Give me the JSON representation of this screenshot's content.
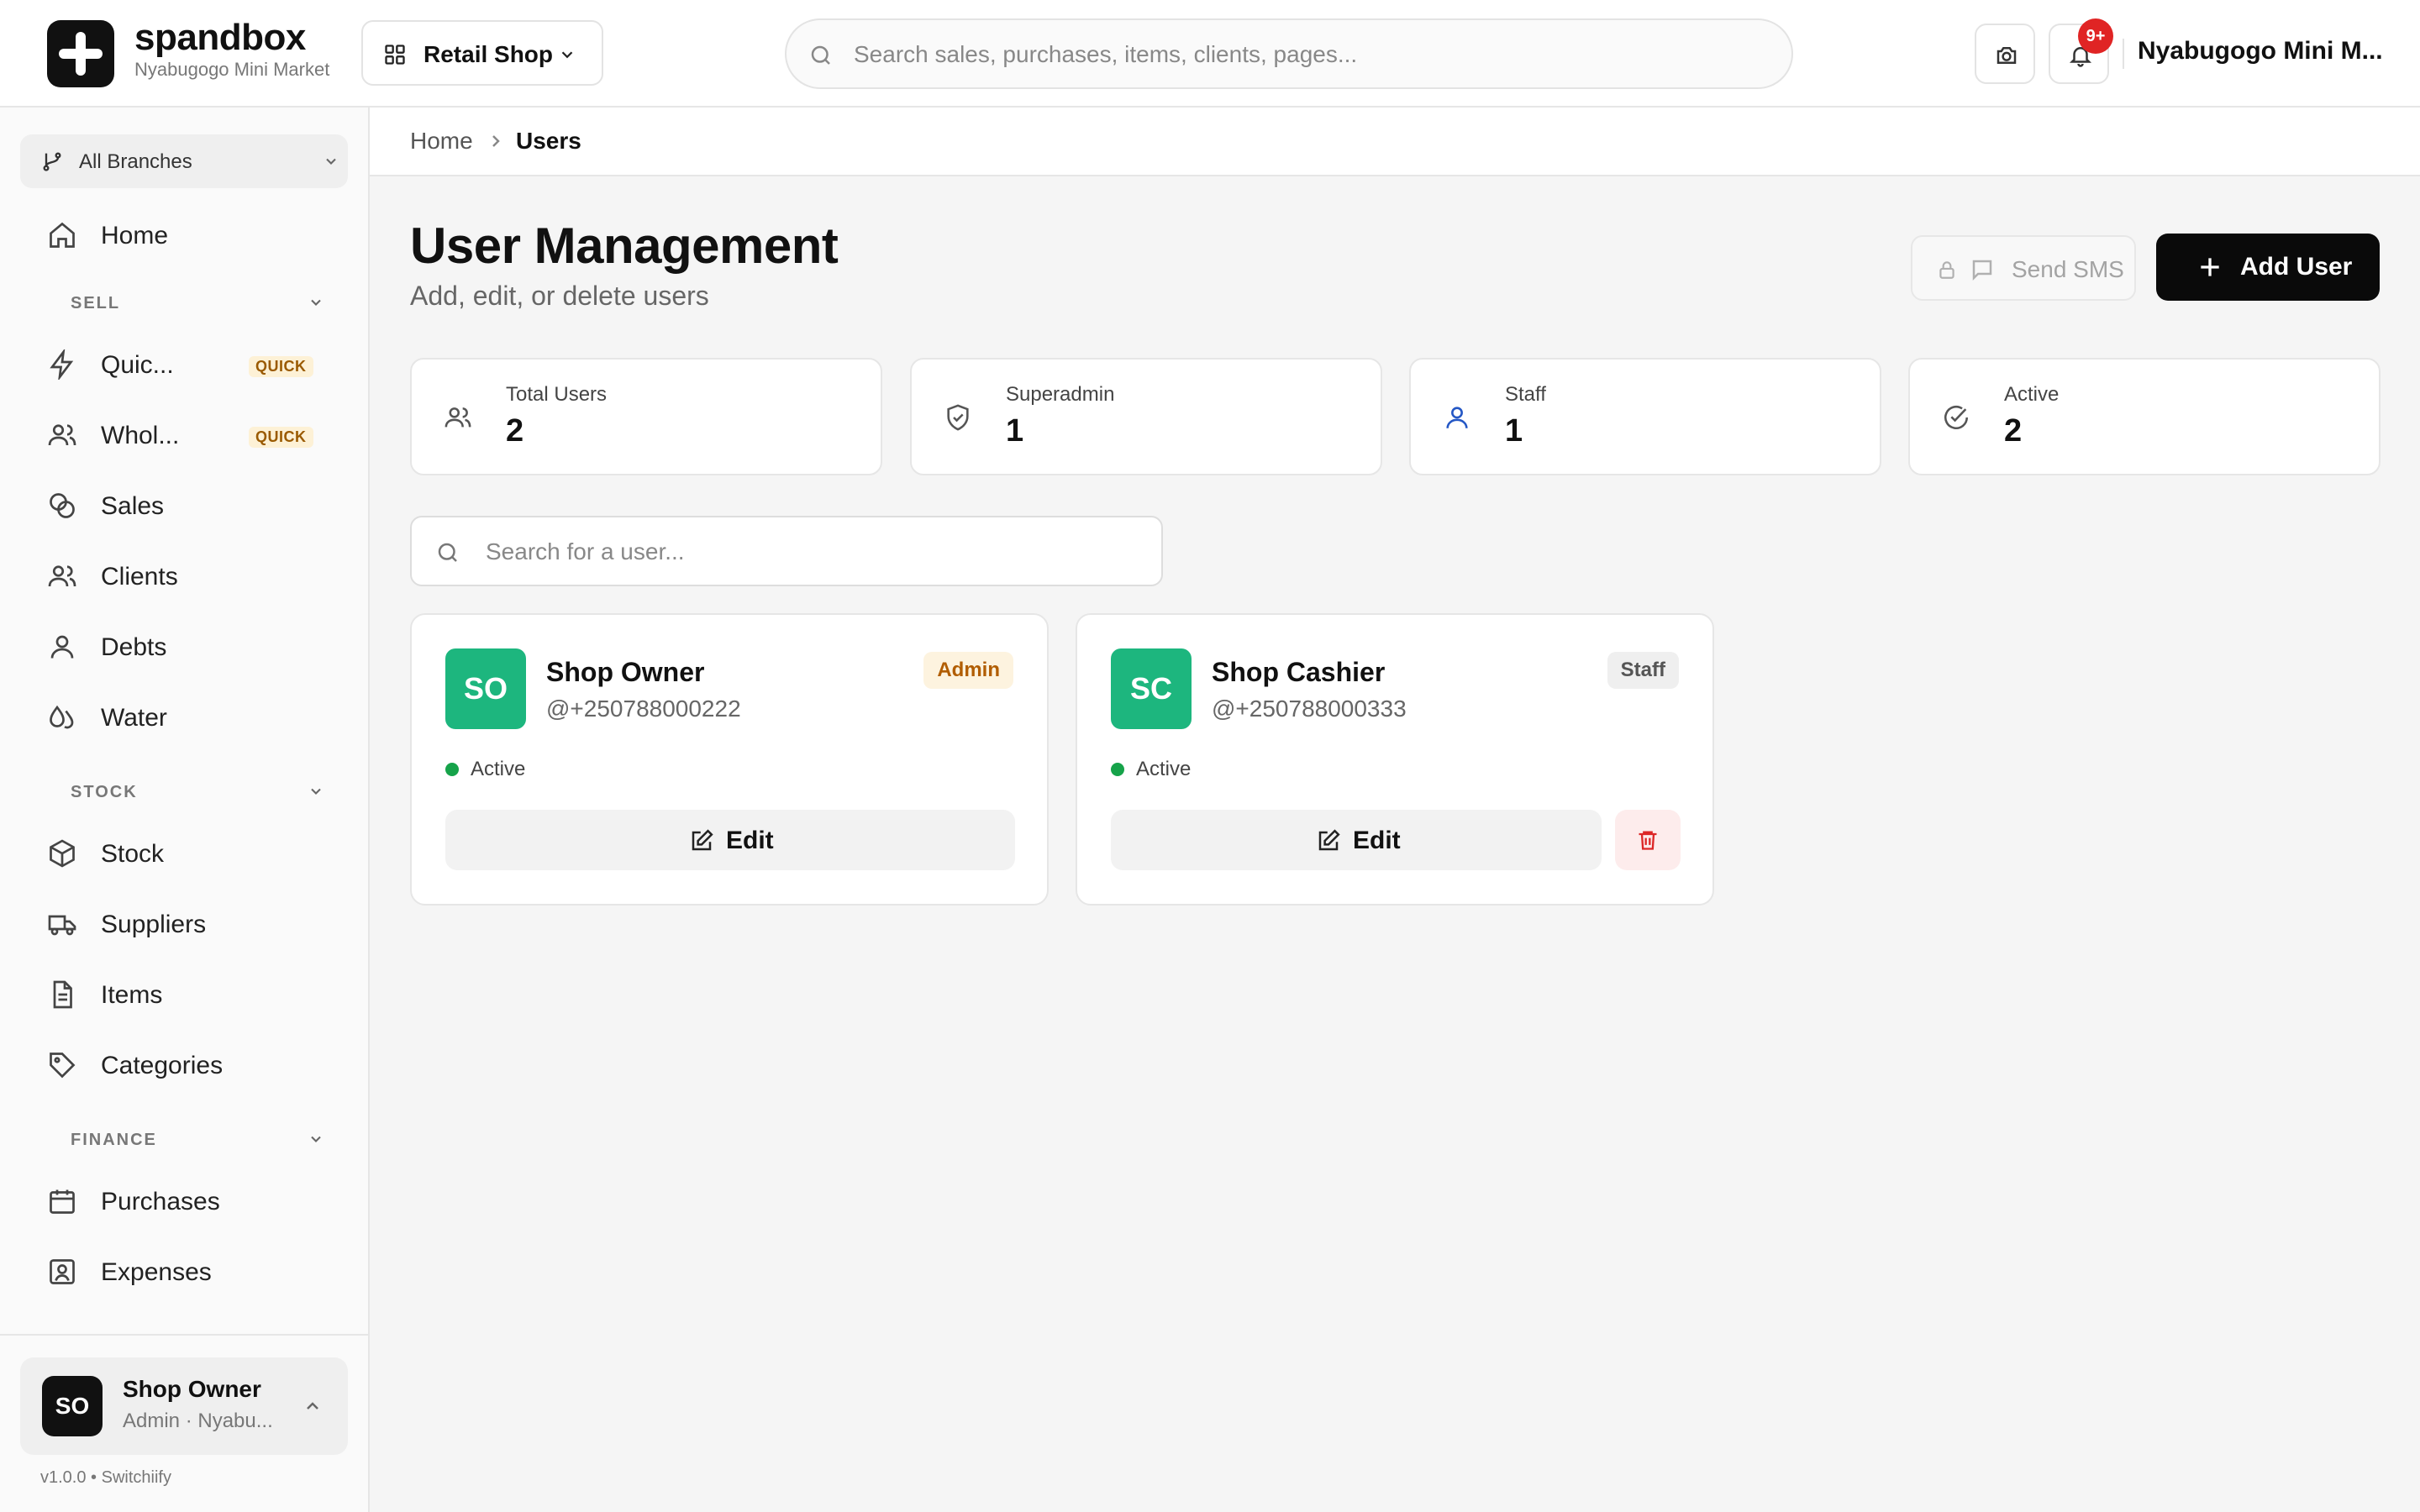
{
  "header": {
    "brand_name": "spandbox",
    "brand_sub": "Nyabugogo Mini Market",
    "shop_selector": "Retail Shop",
    "search_placeholder": "Search sales, purchases, items, clients, pages...",
    "notification_count": "9+",
    "account_name": "Nyabugogo Mini M..."
  },
  "sidebar": {
    "branch_selector": "All Branches",
    "home": "Home",
    "sections": {
      "sell": "SELL",
      "stock": "STOCK",
      "finance": "FINANCE"
    },
    "sell_items": [
      {
        "label": "Quic...",
        "badge": "QUICK"
      },
      {
        "label": "Whol...",
        "badge": "QUICK"
      },
      {
        "label": "Sales"
      },
      {
        "label": "Clients"
      },
      {
        "label": "Debts"
      },
      {
        "label": "Water"
      }
    ],
    "stock_items": [
      {
        "label": "Stock"
      },
      {
        "label": "Suppliers"
      },
      {
        "label": "Items"
      },
      {
        "label": "Categories"
      }
    ],
    "finance_items": [
      {
        "label": "Purchases"
      },
      {
        "label": "Expenses"
      }
    ],
    "current_user": {
      "initials": "SO",
      "name": "Shop Owner",
      "role": "Admin · Nyabu..."
    },
    "version": "v1.0.0 • Switchiify"
  },
  "breadcrumb": {
    "home": "Home",
    "current": "Users"
  },
  "page": {
    "title": "User Management",
    "subtitle": "Add, edit, or delete users",
    "send_sms_label": "Send SMS",
    "add_user_label": "Add User"
  },
  "stats": [
    {
      "label": "Total Users",
      "value": "2"
    },
    {
      "label": "Superadmin",
      "value": "1"
    },
    {
      "label": "Staff",
      "value": "1"
    },
    {
      "label": "Active",
      "value": "2"
    }
  ],
  "user_search_placeholder": "Search for a user...",
  "users": [
    {
      "initials": "SO",
      "name": "Shop Owner",
      "handle": "@+250788000222",
      "role": "Admin",
      "status": "Active",
      "edit_label": "Edit"
    },
    {
      "initials": "SC",
      "name": "Shop Cashier",
      "handle": "@+250788000333",
      "role": "Staff",
      "status": "Active",
      "edit_label": "Edit"
    }
  ],
  "colors": {
    "primary": "#0a0a0a",
    "avatar_green": "#1db67e",
    "active_green": "#16a34a",
    "admin_badge": "#b15d00",
    "delete_red": "#dc2626",
    "notification_red": "#e02424"
  }
}
